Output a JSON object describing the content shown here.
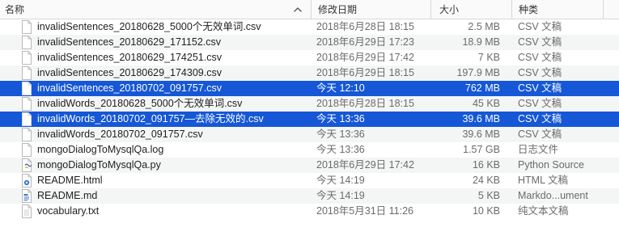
{
  "columns": {
    "name": "名称",
    "date": "修改日期",
    "size": "大小",
    "kind": "种类"
  },
  "files": [
    {
      "name": "invalidSentences_20180628_5000个无效单词.csv",
      "date": "2018年6月28日 18:15",
      "size": "2.5 MB",
      "kind": "CSV 文稿",
      "icon": "document-icon",
      "selected": false
    },
    {
      "name": "invalidSentences_20180629_171152.csv",
      "date": "2018年6月29日 17:23",
      "size": "18.9 MB",
      "kind": "CSV 文稿",
      "icon": "document-icon",
      "selected": false
    },
    {
      "name": "invalidSentences_20180629_174251.csv",
      "date": "2018年6月29日 17:42",
      "size": "7 KB",
      "kind": "CSV 文稿",
      "icon": "document-icon",
      "selected": false
    },
    {
      "name": "invalidSentences_20180629_174309.csv",
      "date": "2018年6月29日 18:15",
      "size": "197.9 MB",
      "kind": "CSV 文稿",
      "icon": "document-icon",
      "selected": false
    },
    {
      "name": "invalidSentences_20180702_091757.csv",
      "date": "今天 12:10",
      "size": "762 MB",
      "kind": "CSV 文稿",
      "icon": "document-icon",
      "selected": true
    },
    {
      "name": "invalidWords_20180628_5000个无效单词.csv",
      "date": "2018年6月28日 18:15",
      "size": "45 KB",
      "kind": "CSV 文稿",
      "icon": "document-icon",
      "selected": false
    },
    {
      "name": "invalidWords_20180702_091757—去除无效的.csv",
      "date": "今天 13:36",
      "size": "39.6 MB",
      "kind": "CSV 文稿",
      "icon": "document-icon",
      "selected": true
    },
    {
      "name": "invalidWords_20180702_091757.csv",
      "date": "今天 13:36",
      "size": "39.6 MB",
      "kind": "CSV 文稿",
      "icon": "document-icon",
      "selected": false
    },
    {
      "name": "mongoDialogToMysqlQa.log",
      "date": "今天 13:36",
      "size": "1.57 GB",
      "kind": "日志文件",
      "icon": "document-icon",
      "selected": false
    },
    {
      "name": "mongoDialogToMysqlQa.py",
      "date": "2018年6月29日 17:42",
      "size": "16 KB",
      "kind": "Python Source",
      "icon": "python-file-icon",
      "selected": false
    },
    {
      "name": "README.html",
      "date": "今天 14:19",
      "size": "24 KB",
      "kind": "HTML 文稿",
      "icon": "html-file-icon",
      "selected": false
    },
    {
      "name": "README.md",
      "date": "今天 14:19",
      "size": "5 KB",
      "kind": "Markdo...ument",
      "icon": "markdown-file-icon",
      "selected": false
    },
    {
      "name": "vocabulary.txt",
      "date": "2018年5月31日 11:26",
      "size": "10 KB",
      "kind": "纯文本文稿",
      "icon": "text-file-icon",
      "selected": false
    }
  ],
  "colors": {
    "selection": "#1557d6",
    "alt_row": "#f4f5f5",
    "header_bg": "#fafafa"
  }
}
